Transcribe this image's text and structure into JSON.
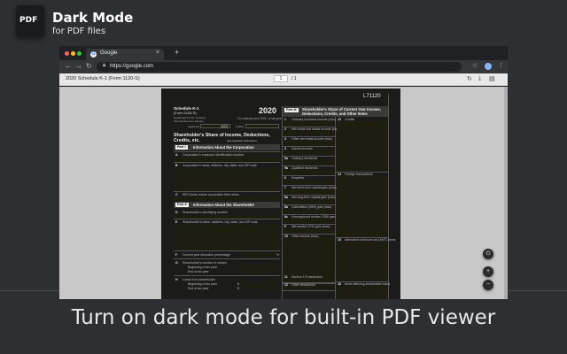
{
  "brand": {
    "logo_text": "PDF",
    "title": "Dark Mode",
    "subtitle": "for PDF files"
  },
  "tagline": "Turn on dark mode for built-in PDF viewer",
  "browser": {
    "tab_title": "Google",
    "tab_close": "×",
    "new_tab": "+",
    "url": "https://google.com",
    "colors": {
      "close": "#ff5f57",
      "minimize": "#febc2e",
      "maximize": "#28c840"
    }
  },
  "pdf_toolbar": {
    "title": "2020 Schedule K-1 (Form 1120-S)",
    "page_current": "1",
    "page_total": "/ 1"
  },
  "pdf_page": {
    "form_number": "L71120",
    "schedule_title": "Schedule K-1",
    "form_ref": "(Form 1120-S)",
    "year": "2020",
    "year_box": "2020",
    "dept": "Department of the Treasury",
    "irs": "Internal Revenue Service",
    "calendar_note": "For calendar year 2020, or tax year",
    "beginning": "beginning",
    "ending": "ending",
    "share_title_1": "Shareholder's Share of Income, Deductions,",
    "share_title_2": "Credits, etc.",
    "instructions": "See separate instructions.",
    "part1_badge": "Part I",
    "part1_title": "Information About the Corporation",
    "part2_badge": "Part II",
    "part2_title": "Information About the Shareholder",
    "part3_badge": "Part III",
    "part3_title_1": "Shareholder's Share of Current Year Income,",
    "part3_title_2": "Deductions, Credits, and Other Items",
    "row_a": "Corporation's employer identification number",
    "row_b": "Corporation's name, address, city, state, and ZIP code",
    "row_c": "IRS Center where corporation filed return",
    "row_d": "Shareholder's identifying number",
    "row_e": "Shareholder's name, address, city, state, and ZIP code",
    "row_f": "Current year allocation percentage",
    "row_f_pct": "%",
    "row_g": "Shareholder's number of shares",
    "row_g1": "Beginning of tax year",
    "row_g2": "End of tax year",
    "row_h": "Loans from shareholder",
    "row_h1": "Beginning of tax year",
    "row_h2": "End of tax year",
    "dollar": "$",
    "lines": [
      {
        "n": "1",
        "t": "Ordinary business income (loss)"
      },
      {
        "n": "2",
        "t": "Net rental real estate income (loss)"
      },
      {
        "n": "3",
        "t": "Other net rental income (loss)"
      },
      {
        "n": "4",
        "t": "Interest income"
      },
      {
        "n": "5a",
        "t": "Ordinary dividends"
      },
      {
        "n": "5b",
        "t": "Qualified dividends"
      },
      {
        "n": "6",
        "t": "Royalties"
      },
      {
        "n": "7",
        "t": "Net short-term capital gain (loss)"
      },
      {
        "n": "8a",
        "t": "Net long-term capital gain (loss)"
      },
      {
        "n": "8b",
        "t": "Collectibles (28%) gain (loss)"
      },
      {
        "n": "8c",
        "t": "Unrecaptured section 1250 gain"
      },
      {
        "n": "9",
        "t": "Net section 1231 gain (loss)"
      },
      {
        "n": "10",
        "t": "Other income (loss)"
      }
    ],
    "lines_bottom": [
      {
        "n": "11",
        "t": "Section 179 deduction"
      },
      {
        "n": "12",
        "t": "Other deductions"
      }
    ],
    "right_lines": [
      {
        "n": "13",
        "t": "Credits"
      },
      {
        "n": "14",
        "t": "Foreign transactions"
      },
      {
        "n": "15",
        "t": "Alternative minimum tax (AMT) items"
      },
      {
        "n": "16",
        "t": "Items affecting shareholder basis"
      }
    ]
  }
}
